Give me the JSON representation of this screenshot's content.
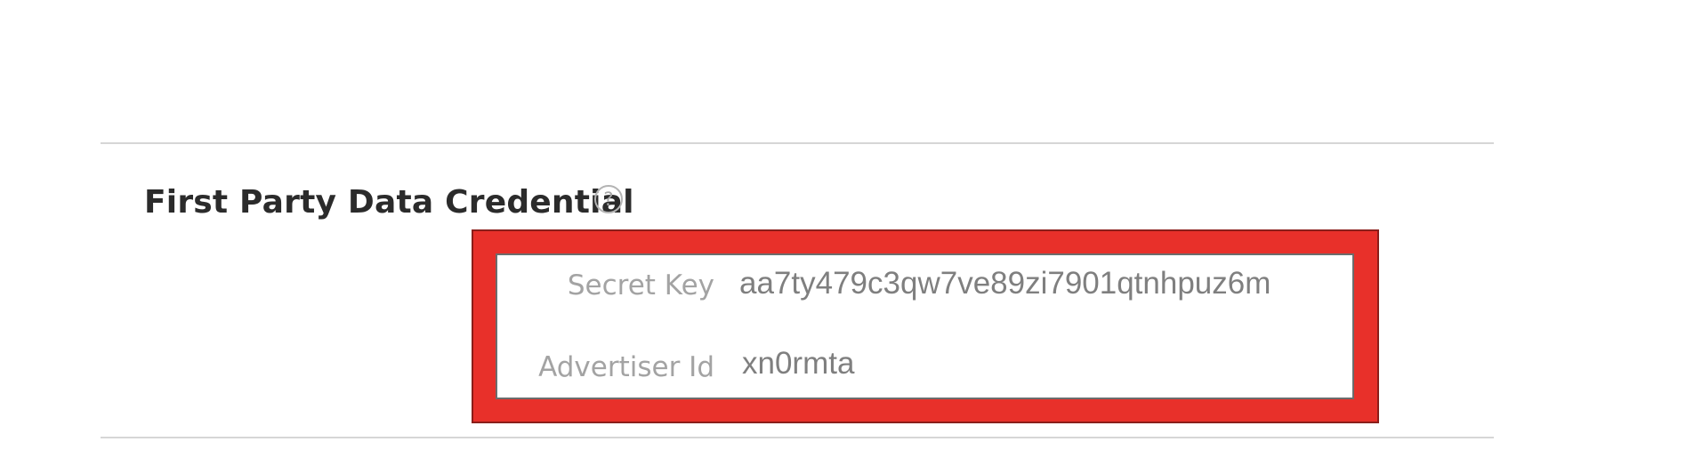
{
  "section": {
    "title": "First Party Data Credential",
    "help_icon": "question-circle-icon"
  },
  "credentials": {
    "secret_key": {
      "label": "Secret Key",
      "value": "aa7ty479c3qw7ve89zi7901qtnhpuz6m"
    },
    "advertiser_id": {
      "label": "Advertiser Id",
      "value": "xn0rmta"
    }
  },
  "colors": {
    "highlight": "#e8302a",
    "divider": "#d6d6d6",
    "title_text": "#2b2b2b",
    "label_text": "#a3a3a3",
    "value_text": "#7f7f7f"
  }
}
